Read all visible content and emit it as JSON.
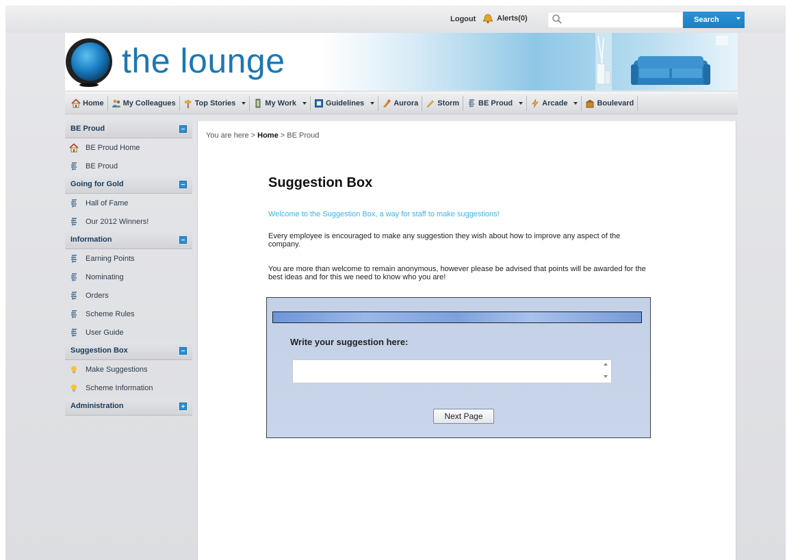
{
  "topbar": {
    "logout": "Logout",
    "alerts": "Alerts(0)",
    "search_placeholder": "",
    "search_label": "Search"
  },
  "header": {
    "logo_text": "the lounge"
  },
  "nav": [
    {
      "label": "Home",
      "icon": "home-icon",
      "dropdown": false
    },
    {
      "label": "My Colleagues",
      "icon": "colleagues-icon",
      "dropdown": false
    },
    {
      "label": "Top Stories",
      "icon": "signpost-icon",
      "dropdown": true
    },
    {
      "label": "My Work",
      "icon": "work-icon",
      "dropdown": true
    },
    {
      "label": "Guidelines",
      "icon": "guidelines-icon",
      "dropdown": true
    },
    {
      "label": "Aurora",
      "icon": "aurora-icon",
      "dropdown": false
    },
    {
      "label": "Storm",
      "icon": "pencil-icon",
      "dropdown": false
    },
    {
      "label": "BE Proud",
      "icon": "be-proud-icon",
      "dropdown": true
    },
    {
      "label": "Arcade",
      "icon": "arcade-icon",
      "dropdown": true
    },
    {
      "label": "Boulevard",
      "icon": "boulevard-icon",
      "dropdown": false
    }
  ],
  "sidebar": {
    "sections": [
      {
        "title": "BE Proud",
        "expanded": true,
        "items": [
          {
            "label": "BE Proud Home",
            "icon": "home-icon"
          },
          {
            "label": "BE Proud",
            "icon": "be-proud-icon"
          }
        ]
      },
      {
        "title": "Going for Gold",
        "expanded": true,
        "items": [
          {
            "label": "Hall of Fame",
            "icon": "be-proud-icon"
          },
          {
            "label": "Our 2012 Winners!",
            "icon": "be-proud-icon"
          }
        ]
      },
      {
        "title": "Information",
        "expanded": true,
        "items": [
          {
            "label": "Earning Points",
            "icon": "be-proud-icon"
          },
          {
            "label": "Nominating",
            "icon": "be-proud-icon"
          },
          {
            "label": "Orders",
            "icon": "be-proud-icon"
          },
          {
            "label": "Scheme Rules",
            "icon": "be-proud-icon"
          },
          {
            "label": "User Guide",
            "icon": "be-proud-icon"
          }
        ]
      },
      {
        "title": "Suggestion Box",
        "expanded": true,
        "items": [
          {
            "label": "Make Suggestions",
            "icon": "lightbulb-icon"
          },
          {
            "label": "Scheme Information",
            "icon": "lightbulb-icon"
          }
        ]
      },
      {
        "title": "Administration",
        "expanded": false,
        "items": []
      }
    ]
  },
  "breadcrumb": {
    "prefix": "You are here >",
    "home": "Home",
    "sep": ">",
    "current": "BE Proud"
  },
  "main": {
    "title": "Suggestion Box",
    "welcome": "Welcome to the Suggestion Box, a way for staff to make suggestions!",
    "para1": "Every employee is encouraged to make any suggestion they wish about how to improve any aspect of the company.",
    "para2": "You are more than welcome to remain anonymous, however please be advised that points will be awarded for the best ideas and for this we need to know who you are!",
    "form": {
      "label": "Write your suggestion here:",
      "value": "",
      "next_label": "Next Page"
    }
  },
  "colors": {
    "accent": "#2b8fd3",
    "welcome_text": "#39b4e6",
    "logo": "#1b78b4"
  }
}
